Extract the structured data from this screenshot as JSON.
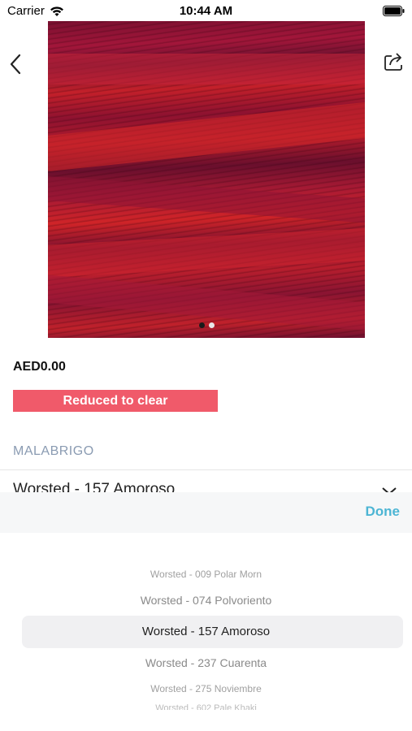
{
  "status_bar": {
    "carrier": "Carrier",
    "time": "10:44 AM"
  },
  "icons": {
    "back": "chevron-left-icon",
    "share": "share-icon",
    "wifi": "wifi-icon",
    "battery": "battery-icon",
    "dropdown": "chevron-down-icon"
  },
  "product": {
    "image_pages": 2,
    "image_active_page": 1,
    "price": "AED0.00",
    "sale_badge": "Reduced to clear",
    "brand": "MALABRIGO",
    "selected_variant": "Worsted - 157 Amoroso"
  },
  "picker": {
    "done_label": "Done",
    "options": [
      "Worsted - 009 Polar Morn",
      "Worsted - 074 Polvoriento",
      "Worsted - 157 Amoroso",
      "Worsted - 237 Cuarenta",
      "Worsted - 275 Noviembre",
      "Worsted - 602 Pale Khaki"
    ],
    "selected_index": 2
  },
  "colors": {
    "badge_bg": "#f05a6a",
    "brand_text": "#8a9bb2",
    "done_text": "#4cb5d4",
    "toolbar_bg": "#f6f7f8"
  }
}
